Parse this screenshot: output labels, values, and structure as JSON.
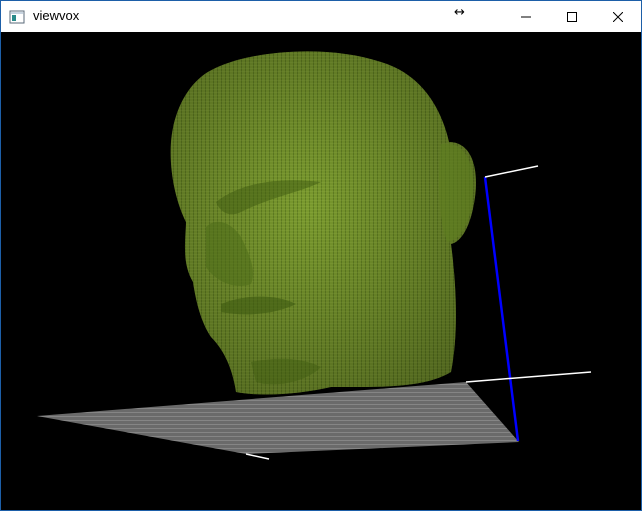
{
  "window": {
    "title": "viewvox",
    "resize_indicator": "↔"
  },
  "controls": {
    "minimize": "minimize",
    "maximize": "maximize",
    "close": "close"
  },
  "scene": {
    "background_color": "#000000",
    "model_color": "#7a9a2e",
    "model_shadow_color": "#4a6a18",
    "floor_color": "#8a8a8a",
    "axis_colors": {
      "x": "#ffffff",
      "y": "#ffffff",
      "z": "#0000ff"
    }
  }
}
